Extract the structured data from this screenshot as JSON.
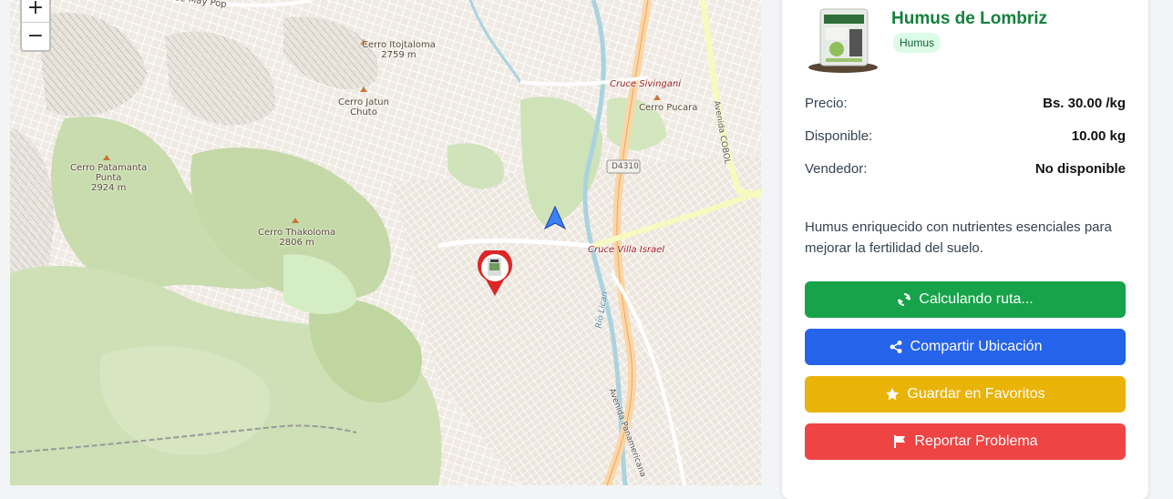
{
  "map": {
    "zoom_in": "+",
    "zoom_out": "−",
    "labels": [
      {
        "name": "cerro-itojtaloma",
        "text": "Cerro Itojtaloma",
        "sub": "2759 m"
      },
      {
        "name": "cerro-jatun-chuto",
        "text": "Cerro Jatun",
        "sub": "Chuto"
      },
      {
        "name": "cerro-patamanta",
        "text": "Cerro Patamanta",
        "sub": "Punta",
        "sub2": "2924 m"
      },
      {
        "name": "cerro-thakoloma",
        "text": "Cerro Thakoloma",
        "sub": "2806 m"
      },
      {
        "name": "cerro-pucara",
        "text": "Cerro Pucara"
      },
      {
        "name": "cruce-sivingani",
        "text": "Cruce Sivingani"
      },
      {
        "name": "cruce-villa-israel",
        "text": "Cruce Villa Israel"
      },
      {
        "name": "road-d4310",
        "text": "D4310"
      },
      {
        "name": "avenida-cobol",
        "text": "Avenida COBOL"
      },
      {
        "name": "rio-lican",
        "text": "Río Lican"
      },
      {
        "name": "avenida-panamericana",
        "text": "Avenida Panamericana"
      },
      {
        "name": "top-street",
        "text": "de May Pop"
      }
    ]
  },
  "product": {
    "title": "Humus de Lombriz",
    "badge": "Humus",
    "price_label": "Precio:",
    "price_value": "Bs. 30.00 /kg",
    "available_label": "Disponible:",
    "available_value": "10.00 kg",
    "seller_label": "Vendedor:",
    "seller_value": "No disponible",
    "description": "Humus enriquecido con nutrientes esenciales para mejorar la fertilidad del suelo."
  },
  "buttons": {
    "route": "Calculando ruta...",
    "share": "Compartir Ubicación",
    "favorite": "Guardar en Favoritos",
    "report": "Reportar Problema"
  },
  "colors": {
    "title_green": "#15803d",
    "route_btn": "#16a34a",
    "share_btn": "#2563eb",
    "favorite_btn": "#eab308",
    "report_btn": "#ef4444",
    "marker_red": "#dc2626",
    "user_arrow": "#3b82f6"
  },
  "icons": {
    "route": "sync-icon",
    "share": "share-icon",
    "favorite": "star-icon",
    "report": "flag-icon"
  }
}
